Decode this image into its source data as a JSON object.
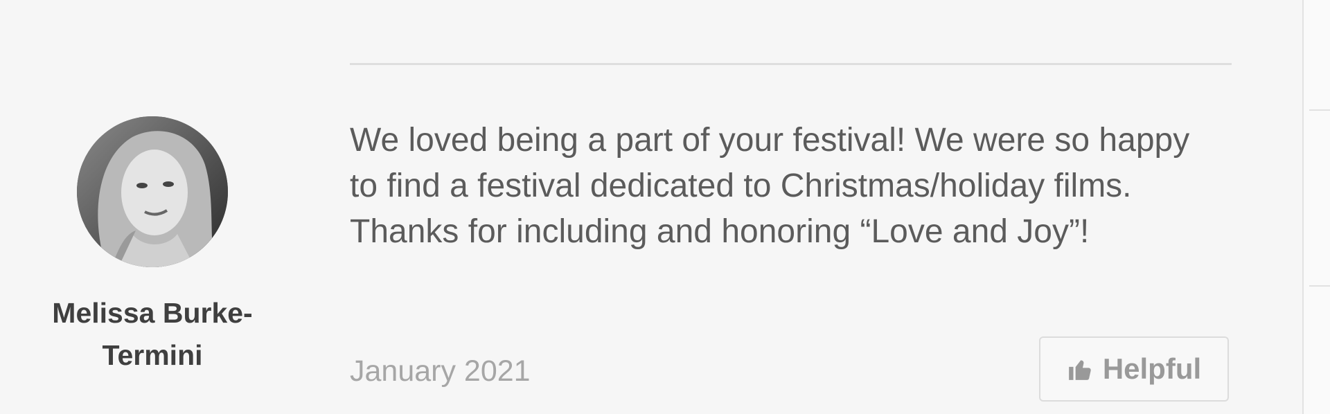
{
  "review": {
    "reviewer_name": "Melissa Burke-Termini",
    "text": "We loved being a part of your festival! We were so happy to find a festival dedicated to Christmas/holiday films. Thanks for including and honoring “Love and Joy”!",
    "date": "January 2021",
    "helpful_label": "Helpful",
    "avatar_icon": "avatar-photo",
    "helpful_icon": "thumbs-up-icon"
  },
  "colors": {
    "background": "#f6f6f6",
    "text": "#5b5b5b",
    "name": "#3f3f3f",
    "muted": "#a6a6a6",
    "divider": "#dedede"
  }
}
